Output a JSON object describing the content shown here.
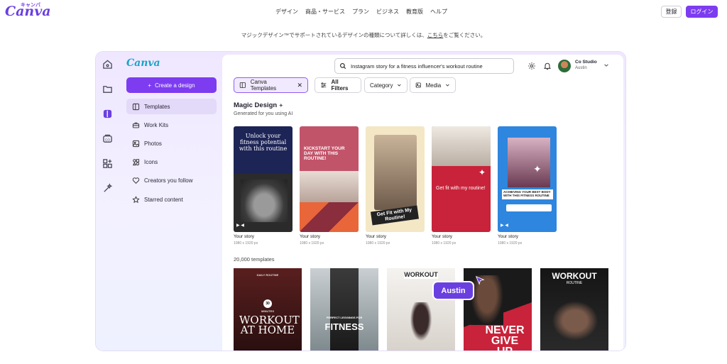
{
  "header": {
    "logo": "Canva",
    "logo_sub": "キャンバ",
    "nav": [
      "デザイン",
      "商品・サービス",
      "プラン",
      "ビジネス",
      "教育版",
      "ヘルプ"
    ],
    "register": "登録",
    "login": "ログイン"
  },
  "notice": {
    "before": "マジックデザイン™でサポートされているデザインの種類について詳しくは、",
    "link": "こちら",
    "after": "をご覧ください。"
  },
  "sidebar": {
    "logo": "Canva",
    "create": "Create a design",
    "items": [
      {
        "label": "Templates",
        "icon": "template-icon"
      },
      {
        "label": "Work Kits",
        "icon": "briefcase-icon"
      },
      {
        "label": "Photos",
        "icon": "photo-icon"
      },
      {
        "label": "Icons",
        "icon": "shapes-icon"
      },
      {
        "label": "Creators you follow",
        "icon": "heart-icon"
      },
      {
        "label": "Starred content",
        "icon": "star-icon"
      }
    ]
  },
  "search": {
    "value": "Instagram story for a fitness influencer's workout routine"
  },
  "account": {
    "name": "Co Studio",
    "sub": "Austin"
  },
  "filters": {
    "selected": "Canva Templates",
    "all": "All Filters",
    "category": "Category",
    "media": "Media"
  },
  "magic": {
    "title": "Magic Design",
    "subtitle": "Generated for you using AI",
    "cards": [
      {
        "label": "Your story",
        "dims": "1080 x 1920 px",
        "text": "Unlock your fitness potential with this routine"
      },
      {
        "label": "Your story",
        "dims": "1080 x 1920 px",
        "text": "KICKSTART YOUR DAY WITH THIS ROUTINE!"
      },
      {
        "label": "Your story",
        "dims": "1080 x 1920 px",
        "text": "Get Fit with My Routine!"
      },
      {
        "label": "Your story",
        "dims": "1080 x 1920 px",
        "text": "Get fit with my routine!"
      },
      {
        "label": "Your story",
        "dims": "1080 x 1920 px",
        "text": "ACHIEVING YOUR BEST BODY WITH THIS FITNESS ROUTINE"
      }
    ]
  },
  "templates": {
    "count": "20,000 templates",
    "items": [
      {
        "top": "DAILY ROUTINE",
        "badge": "30",
        "mid": "MINUTES",
        "main": "WORKOUT AT HOME"
      },
      {
        "top": "PERFECT LEGGINGS FOR",
        "main": "FITNESS"
      },
      {
        "main": "WORKOUT"
      },
      {
        "main": "NEVER GIVE UP"
      },
      {
        "main": "WORKOUT",
        "sub": "ROUTINE"
      }
    ]
  },
  "cursor_label": "Austin",
  "colors": {
    "brand": "#7d3cf0",
    "accent_red": "#c8233a",
    "accent_blue": "#2e86de"
  }
}
